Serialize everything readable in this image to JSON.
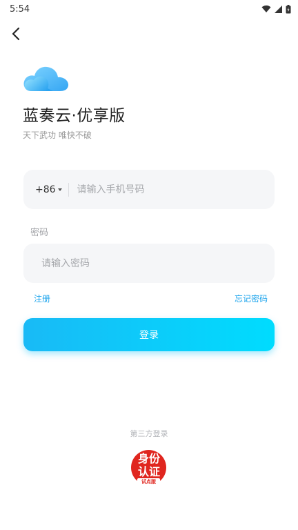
{
  "status_bar": {
    "time": "5:54"
  },
  "app": {
    "title": "蓝奏云·优享版",
    "slogan": "天下武功 唯快不破"
  },
  "phone": {
    "country_code": "+86",
    "placeholder": "请输入手机号码"
  },
  "password": {
    "label": "密码",
    "placeholder": "请输入密码"
  },
  "links": {
    "register": "注册",
    "forgot": "忘记密码"
  },
  "login_button": "登录",
  "third_party": {
    "title": "第三方登录",
    "id_auth": {
      "line1": "身份",
      "line2": "认证",
      "sub": "试点版"
    }
  },
  "colors": {
    "accent": "#1aa3ec",
    "button_start": "#19baf6",
    "button_end": "#00dcfe",
    "badge": "#e0261f"
  }
}
